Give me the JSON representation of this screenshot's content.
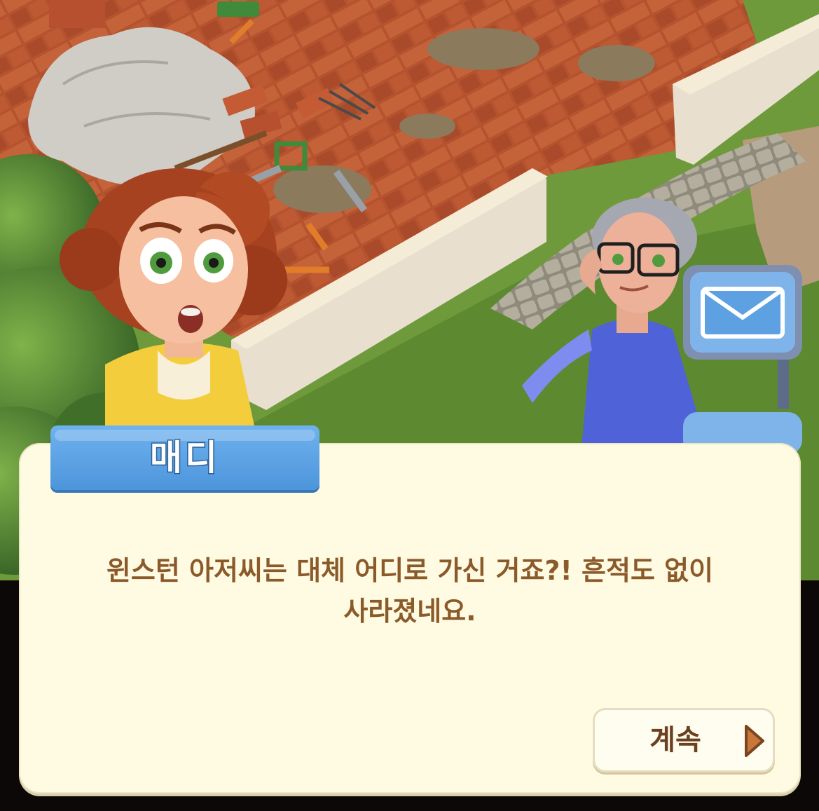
{
  "dialog": {
    "speaker": "매디",
    "line1": "윈스턴 아저씨는 대체 어디로 가신 거죠?! 흔적도 없이",
    "line2": "사라졌네요.",
    "continue_label": "계속"
  },
  "icons": {
    "mail": "envelope-icon",
    "continue": "play-arrow-icon"
  },
  "colors": {
    "panel": "#fffbe2",
    "name_tab": "#5aa3e6",
    "text": "#8b5a2a",
    "button_text": "#6b4220",
    "arrow": "#c7773a"
  }
}
